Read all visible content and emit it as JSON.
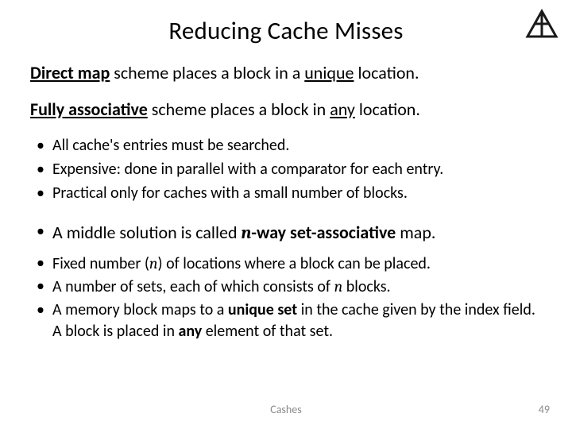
{
  "title": "Reducing Cache Misses",
  "para1": {
    "strong": "Direct map",
    "rest1": " scheme places a block in a ",
    "u": "unique",
    "rest2": " location."
  },
  "para2": {
    "strong": "Fully associative",
    "rest1": " scheme places a block in ",
    "u": "any",
    "rest2": " location."
  },
  "bullets1": [
    "All cache's entries must be searched.",
    "Expensive: done in parallel with a comparator for each entry.",
    "Practical only for caches with a small number of blocks."
  ],
  "mid": {
    "pre": "A middle solution is called ",
    "n": "n",
    "strong_tail": "-way set-associative",
    "post": " map."
  },
  "bullets2": {
    "b1_pre": "Fixed number (",
    "b1_n": "n",
    "b1_post": ") of locations where a block can be placed.",
    "b2_pre": "A number of sets, each of which consists of ",
    "b2_n": "n",
    "b2_post": " blocks.",
    "b3_pre": "A memory block maps to a ",
    "b3_strong": "unique set",
    "b3_mid": " in the cache given by the index field. A block is placed in ",
    "b3_strong2": "any",
    "b3_post": " element of that set."
  },
  "footer_center": "Cashes",
  "footer_right": "49"
}
